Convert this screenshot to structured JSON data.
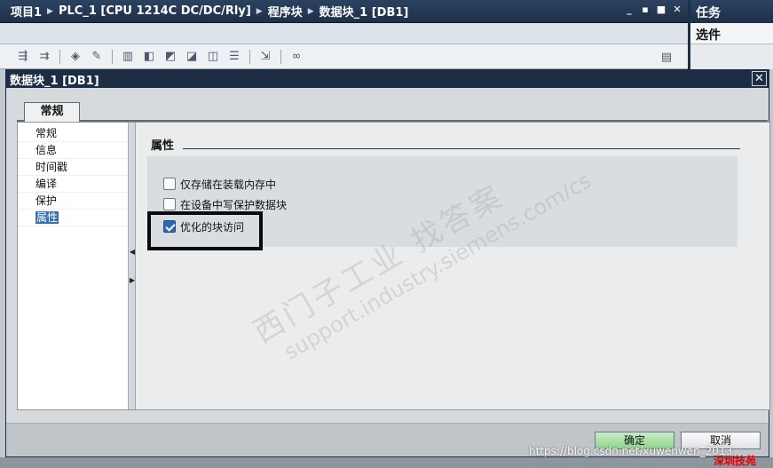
{
  "editor": {
    "breadcrumb": [
      "项目1",
      "PLC_1 [CPU 1214C DC/DC/Rly]",
      "程序块",
      "数据块_1 [DB1]"
    ],
    "window_controls": [
      "_",
      "▪",
      "■",
      "✕"
    ],
    "toolbar_icons": [
      "insert-row-icon",
      "add-row-icon",
      "load-snapshot-icon",
      "edit-icon",
      "monitor-icon",
      "copy-to-start-icon",
      "copy-snapshot-icon",
      "start-value-icon",
      "snapshot-icon",
      "list-icon",
      "expand-icon",
      "glasses-icon"
    ]
  },
  "task_panel": {
    "title": "任务",
    "subtitle": "选件"
  },
  "dialog": {
    "title": "数据块_1 [DB1]",
    "close_glyph": "✕",
    "tabs": [
      {
        "label": "常规",
        "active": true
      }
    ],
    "nav_items": [
      {
        "label": "常规",
        "selected": false
      },
      {
        "label": "信息",
        "selected": false
      },
      {
        "label": "时间戳",
        "selected": false
      },
      {
        "label": "编译",
        "selected": false
      },
      {
        "label": "保护",
        "selected": false
      },
      {
        "label": "属性",
        "selected": true
      }
    ],
    "section_title": "属性",
    "options": [
      {
        "label": "仅存储在装载内存中",
        "checked": false
      },
      {
        "label": "在设备中写保护数据块",
        "checked": false
      },
      {
        "label": "优化的块访问",
        "checked": true
      }
    ],
    "ok_label": "确定",
    "cancel_label": "取消"
  },
  "watermark": {
    "line1": "西门子工业   找答案",
    "line2": "support.industry.siemens.com/cs"
  },
  "credit": {
    "url": "https://blog.csdn.net/xuwenwen_2013",
    "label_cn": "深圳技苑"
  },
  "colors": {
    "title_bar": "#1d2e44",
    "checkbox_checked": "#2f66b2",
    "ok_button": "#93d38f",
    "selection": "#3a6ea5"
  }
}
